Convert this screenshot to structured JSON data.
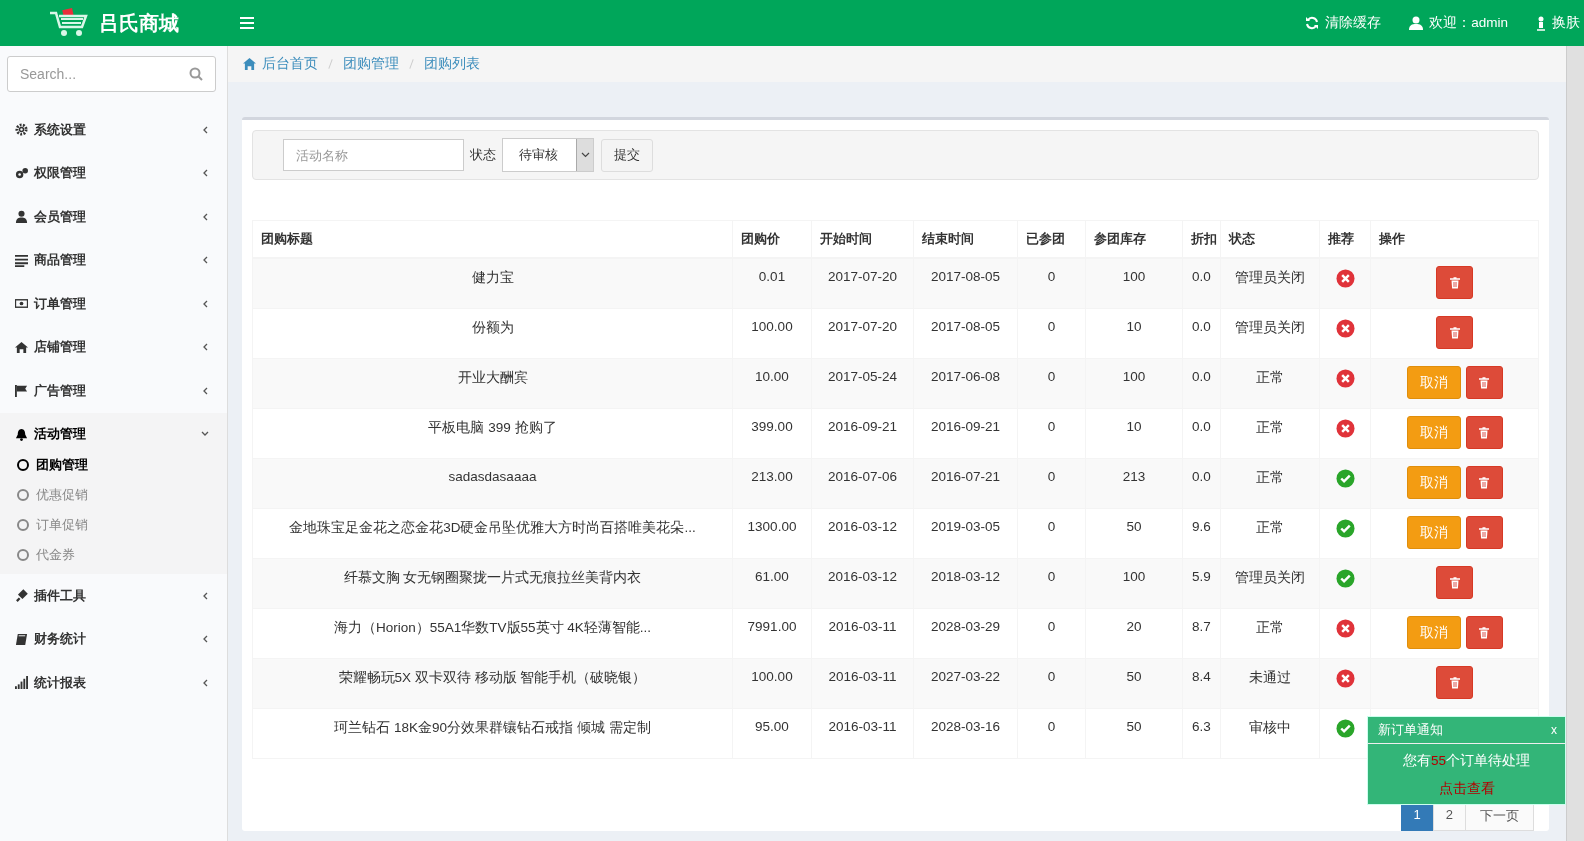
{
  "header": {
    "brand": "吕氏商城",
    "clear_cache": "清除缓存",
    "welcome": "欢迎：admin",
    "skin": "换肤"
  },
  "sidebar": {
    "search_placeholder": "Search...",
    "items": [
      {
        "label": "系统设置",
        "expanded": false
      },
      {
        "label": "权限管理",
        "expanded": false
      },
      {
        "label": "会员管理",
        "expanded": false
      },
      {
        "label": "商品管理",
        "expanded": false
      },
      {
        "label": "订单管理",
        "expanded": false
      },
      {
        "label": "店铺管理",
        "expanded": false
      },
      {
        "label": "广告管理",
        "expanded": false
      },
      {
        "label": "活动管理",
        "expanded": true,
        "children": [
          {
            "label": "团购管理",
            "selected": true
          },
          {
            "label": "优惠促销",
            "selected": false
          },
          {
            "label": "订单促销",
            "selected": false
          },
          {
            "label": "代金券",
            "selected": false
          }
        ]
      },
      {
        "label": "插件工具",
        "expanded": false
      },
      {
        "label": "财务统计",
        "expanded": false
      },
      {
        "label": "统计报表",
        "expanded": false
      }
    ]
  },
  "breadcrumb": [
    "后台首页",
    "团购管理",
    "团购列表"
  ],
  "filter": {
    "name_placeholder": "活动名称",
    "status_label": "状态",
    "status_value": "待审核",
    "submit": "提交"
  },
  "table": {
    "columns": [
      "团购标题",
      "团购价",
      "开始时间",
      "结束时间",
      "已参团",
      "参团库存",
      "折扣",
      "状态",
      "推荐",
      "操作"
    ],
    "rows": [
      {
        "title": "健力宝",
        "price": "0.01",
        "start": "2017-07-20",
        "end": "2017-08-05",
        "joined": "0",
        "stock": "100",
        "discount": "0.0",
        "status": "管理员关闭",
        "recommended": false,
        "actions": [
          {
            "kind": "delete"
          }
        ]
      },
      {
        "title": "份额为",
        "price": "100.00",
        "start": "2017-07-20",
        "end": "2017-08-05",
        "joined": "0",
        "stock": "10",
        "discount": "0.0",
        "status": "管理员关闭",
        "recommended": false,
        "actions": [
          {
            "kind": "delete"
          }
        ]
      },
      {
        "title": "开业大酬宾",
        "price": "10.00",
        "start": "2017-05-24",
        "end": "2017-06-08",
        "joined": "0",
        "stock": "100",
        "discount": "0.0",
        "status": "正常",
        "recommended": false,
        "actions": [
          {
            "kind": "cancel",
            "label": "取消"
          },
          {
            "kind": "delete"
          }
        ]
      },
      {
        "title": "平板电脑 399 抢购了",
        "price": "399.00",
        "start": "2016-09-21",
        "end": "2016-09-21",
        "joined": "0",
        "stock": "10",
        "discount": "0.0",
        "status": "正常",
        "recommended": false,
        "actions": [
          {
            "kind": "cancel",
            "label": "取消"
          },
          {
            "kind": "delete"
          }
        ]
      },
      {
        "title": "sadasdasaaaa",
        "price": "213.00",
        "start": "2016-07-06",
        "end": "2016-07-21",
        "joined": "0",
        "stock": "213",
        "discount": "0.0",
        "status": "正常",
        "recommended": true,
        "actions": [
          {
            "kind": "cancel",
            "label": "取消"
          },
          {
            "kind": "delete"
          }
        ]
      },
      {
        "title": "金地珠宝足金花之恋金花3D硬金吊坠优雅大方时尚百搭唯美花朵...",
        "price": "1300.00",
        "start": "2016-03-12",
        "end": "2019-03-05",
        "joined": "0",
        "stock": "50",
        "discount": "9.6",
        "status": "正常",
        "recommended": true,
        "actions": [
          {
            "kind": "cancel",
            "label": "取消"
          },
          {
            "kind": "delete"
          }
        ]
      },
      {
        "title": "纤慕文胸 女无钢圈聚拢一片式无痕拉丝美背内衣",
        "price": "61.00",
        "start": "2016-03-12",
        "end": "2018-03-12",
        "joined": "0",
        "stock": "100",
        "discount": "5.9",
        "status": "管理员关闭",
        "recommended": true,
        "actions": [
          {
            "kind": "delete"
          }
        ]
      },
      {
        "title": "海力（Horion）55A1华数TV版55英寸 4K轻薄智能...",
        "price": "7991.00",
        "start": "2016-03-11",
        "end": "2028-03-29",
        "joined": "0",
        "stock": "20",
        "discount": "8.7",
        "status": "正常",
        "recommended": false,
        "actions": [
          {
            "kind": "cancel",
            "label": "取消"
          },
          {
            "kind": "delete"
          }
        ]
      },
      {
        "title": "荣耀畅玩5X 双卡双待 移动版 智能手机（破晓银）",
        "price": "100.00",
        "start": "2016-03-11",
        "end": "2027-03-22",
        "joined": "0",
        "stock": "50",
        "discount": "8.4",
        "status": "未通过",
        "recommended": false,
        "actions": [
          {
            "kind": "delete"
          }
        ]
      },
      {
        "title": "珂兰钻石 18K金90分效果群镶钻石戒指 倾城 需定制",
        "price": "95.00",
        "start": "2016-03-11",
        "end": "2028-03-16",
        "joined": "0",
        "stock": "50",
        "discount": "6.3",
        "status": "审核中",
        "recommended": true
      }
    ]
  },
  "pagination": [
    {
      "label": "1",
      "selected": true
    },
    {
      "label": "2",
      "selected": false
    },
    {
      "label": "下一页",
      "selected": false
    }
  ],
  "notification": {
    "title": "新订单通知",
    "close": "x",
    "message_before": "您有",
    "count": "55",
    "message_after": "个订单待处理",
    "link": "点击查看"
  }
}
